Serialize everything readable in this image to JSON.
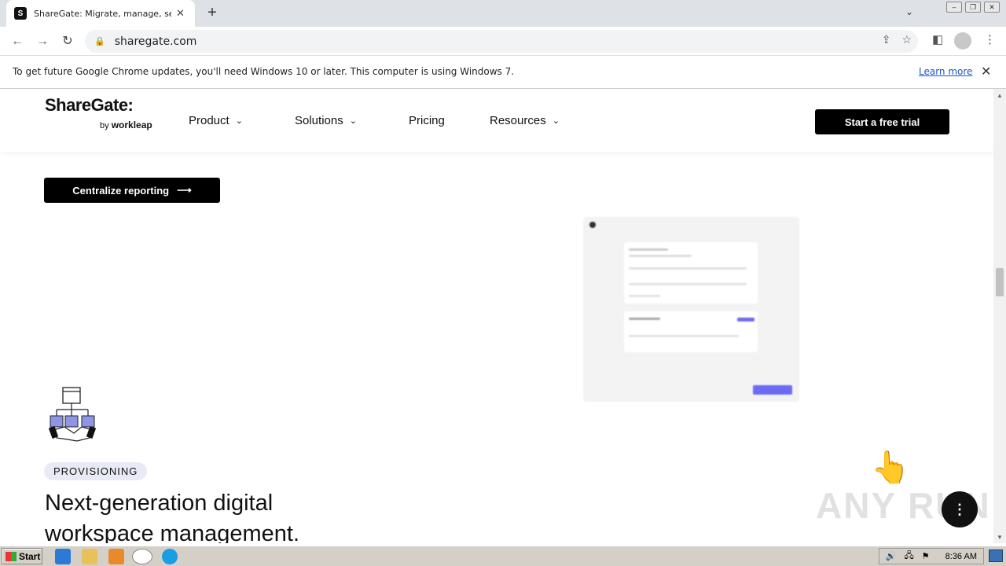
{
  "browser": {
    "tab_title": "ShareGate: Migrate, manage, secure",
    "url": "sharegate.com",
    "new_tab": "+"
  },
  "infobar": {
    "message": "To get future Google Chrome updates, you'll need Windows 10 or later. This computer is using Windows 7.",
    "link": "Learn more"
  },
  "site": {
    "logo": "ShareGate:",
    "logo_by": "by",
    "logo_brand": "workleap",
    "nav": [
      {
        "label": "Product"
      },
      {
        "label": "Solutions"
      },
      {
        "label": "Pricing"
      },
      {
        "label": "Resources"
      }
    ],
    "cta": "Start a free trial",
    "centralize_button": "Centralize reporting",
    "badge": "PROVISIONING",
    "headline": "Next-generation digital workspace management."
  },
  "watermark": "ANY RUN",
  "taskbar": {
    "start": "Start",
    "time": "8:36 AM"
  },
  "colors": {
    "accent": "#6c6cf2",
    "chrome_bg": "#dee1e6",
    "taskbar": "#d4d0c8"
  }
}
